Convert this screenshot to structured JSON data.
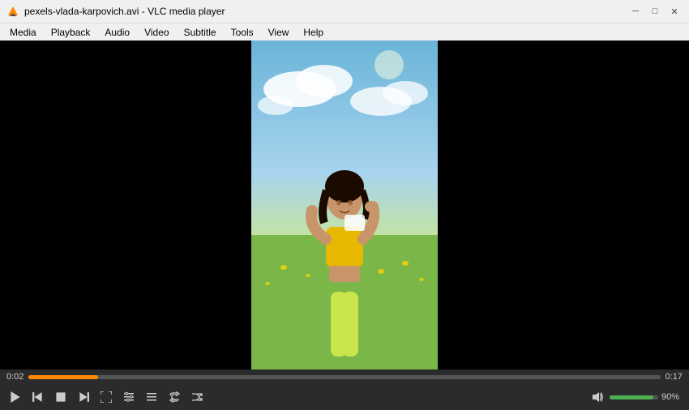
{
  "titlebar": {
    "title": "pexels-vlada-karpovich.avi - VLC media player",
    "minimize_label": "─",
    "maximize_label": "□",
    "close_label": "✕"
  },
  "menubar": {
    "items": [
      {
        "label": "Media"
      },
      {
        "label": "Playback"
      },
      {
        "label": "Audio"
      },
      {
        "label": "Video"
      },
      {
        "label": "Subtitle"
      },
      {
        "label": "Tools"
      },
      {
        "label": "View"
      },
      {
        "label": "Help"
      }
    ]
  },
  "player": {
    "time_current": "0:02",
    "time_total": "0:17",
    "progress_percent": 11,
    "volume_percent": "90%",
    "volume_bar_width": 90
  },
  "controls": {
    "play_label": "▶",
    "stop_label": "■",
    "prev_label": "⏮",
    "next_label": "⏭",
    "fullscreen_label": "⛶",
    "extended_label": "≡",
    "playlist_label": "☰",
    "loop_label": "↺",
    "random_label": "⇄",
    "frame_label": "⏹"
  }
}
